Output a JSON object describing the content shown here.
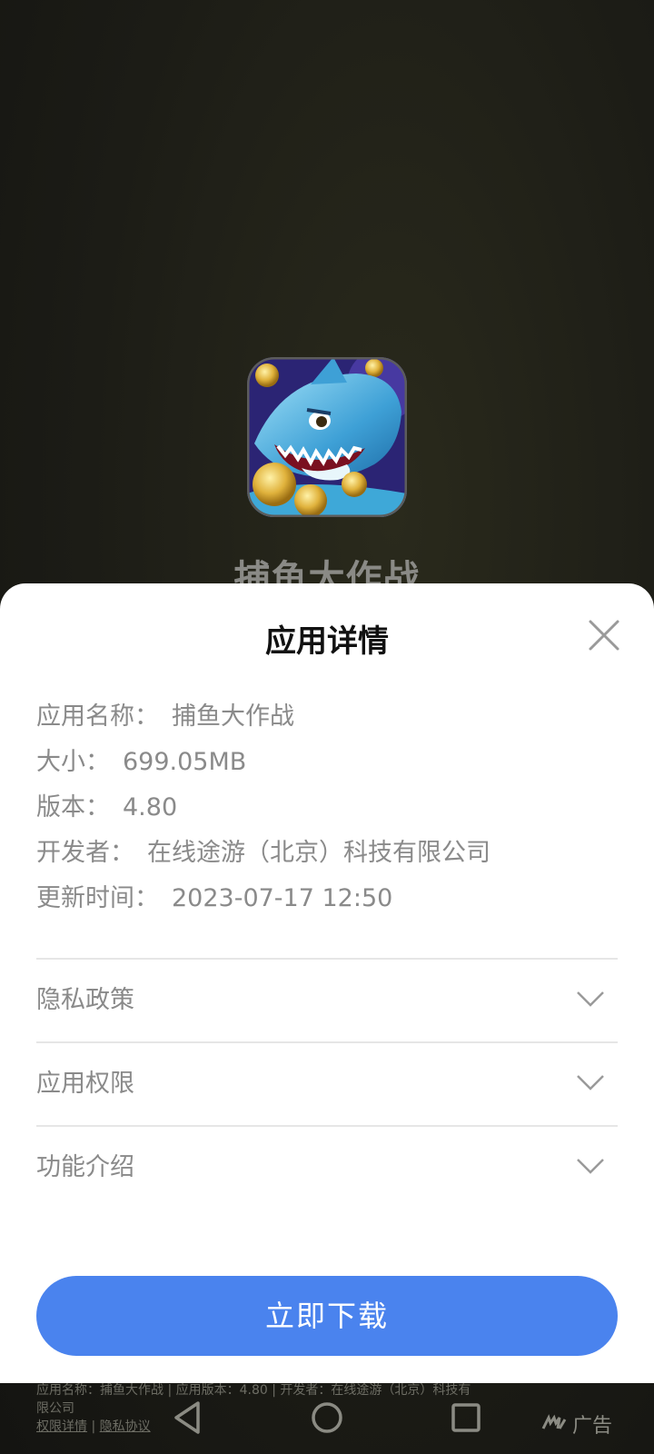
{
  "background_app": {
    "name": "捕鱼大作战",
    "icon": "shark-game-icon"
  },
  "sheet": {
    "title": "应用详情",
    "close_icon": "close-icon",
    "info": [
      {
        "label": "应用名称：",
        "value": "捕鱼大作战"
      },
      {
        "label": "大小：",
        "value": "699.05MB"
      },
      {
        "label": "版本：",
        "value": "4.80"
      },
      {
        "label": "开发者：",
        "value": "在线途游（北京）科技有限公司"
      },
      {
        "label": "更新时间：",
        "value": "2023-07-17 12:50"
      }
    ],
    "sections": [
      {
        "label": "隐私政策"
      },
      {
        "label": "应用权限"
      },
      {
        "label": "功能介绍"
      }
    ],
    "download_label": "立即下载"
  },
  "footer": {
    "info_line1": "应用名称：捕鱼大作战 | 应用版本：4.80 | 开发者：在线途游（北京）科技有",
    "info_line2": "限公司",
    "permission_link": "权限详情",
    "separator": " | ",
    "privacy_link": "隐私协议"
  },
  "ad": {
    "label": "广告",
    "icon": "ad-brand-icon"
  },
  "navbar": {
    "back_icon": "back-triangle-icon",
    "home_icon": "home-circle-icon",
    "recent_icon": "recent-square-icon"
  },
  "colors": {
    "accent": "#4a83ee",
    "overlay_bg": "#1b1b14",
    "muted_text": "#8a8a8a"
  }
}
